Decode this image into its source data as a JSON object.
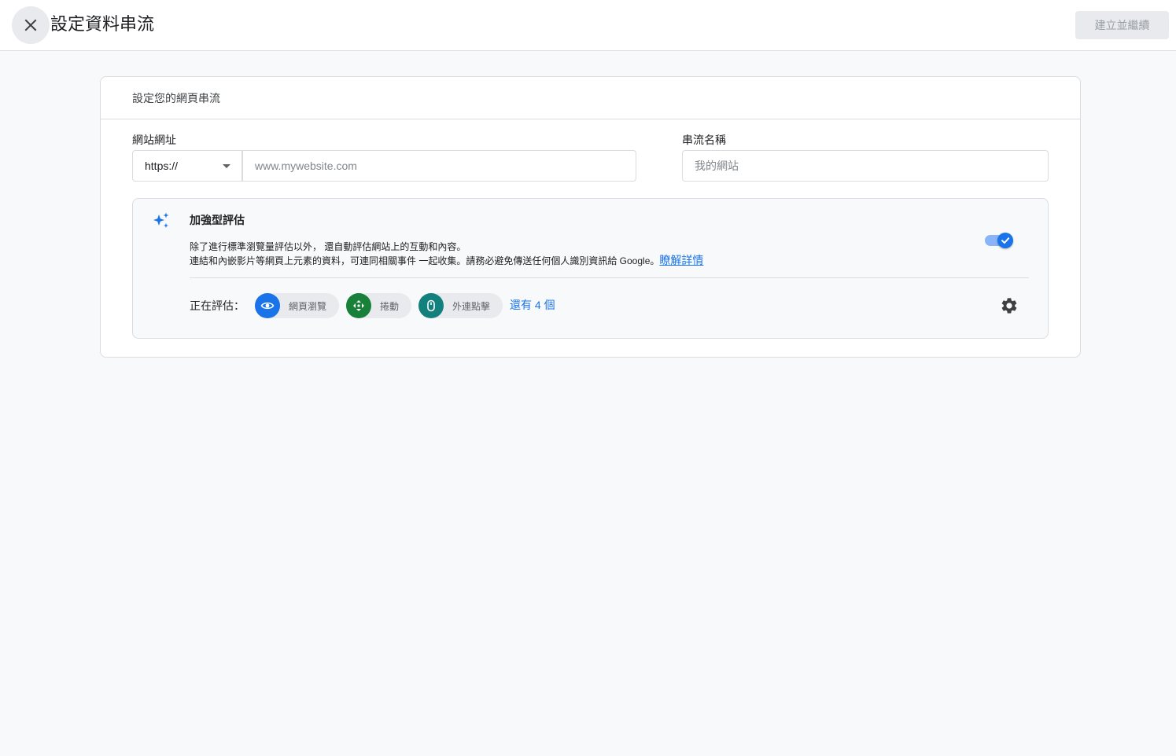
{
  "header": {
    "title": "設定資料串流",
    "close_icon": "close-icon",
    "primary_button": "建立並繼續"
  },
  "card": {
    "title": "設定您的網頁串流",
    "url_field": {
      "label": "網站網址",
      "protocol": "https://",
      "placeholder": "www.mywebsite.com"
    },
    "name_field": {
      "label": "串流名稱",
      "placeholder": "我的網站"
    },
    "enhanced_measurement": {
      "icon": "sparkle-icon",
      "title": "加強型評估",
      "desc_line1": "除了進行標準瀏覽量評估以外， 還自動評估網站上的互動和內容。",
      "desc_line2": "連結和內嵌影片等網頁上元素的資料，可連同相關事件 一起收集。請務必避免傳送任何個人識別資訊給 Google。",
      "learn_more": "瞭解詳情",
      "enabled": true,
      "measuring_label": "正在評估：",
      "chips": [
        {
          "label": "網頁瀏覽",
          "icon": "eye-icon",
          "color": "#1a73e8"
        },
        {
          "label": "捲動",
          "icon": "scroll-arrows-icon",
          "color": "#188038"
        },
        {
          "label": "外連點擊",
          "icon": "mouse-icon",
          "color": "#12817e"
        }
      ],
      "more_link": "還有 4 個",
      "settings_icon": "gear-icon"
    }
  },
  "colors": {
    "accent": "#1a73e8",
    "background": "#f8f9fa"
  }
}
